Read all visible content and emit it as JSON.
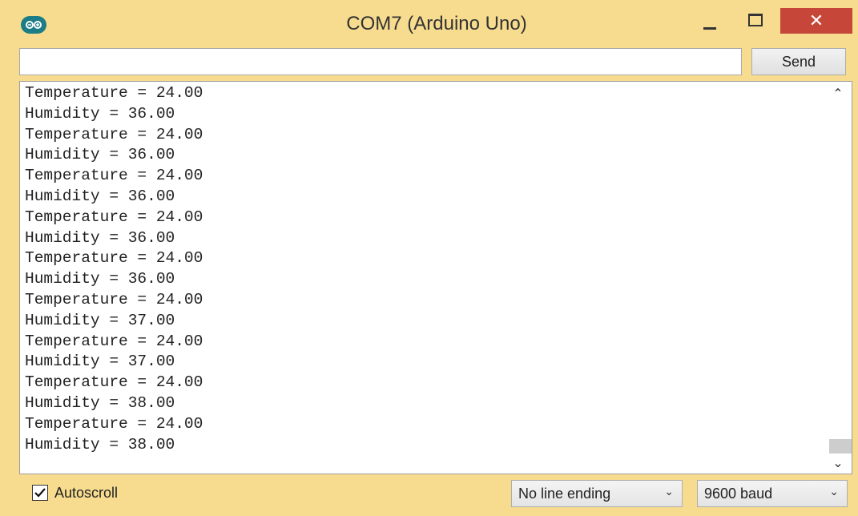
{
  "window": {
    "title": "COM7 (Arduino Uno)",
    "close_glyph": "✕",
    "accent_color": "#f7dc8f",
    "close_color": "#c7463a"
  },
  "icons": {
    "app": "arduino-logo-icon",
    "minimize": "minimize-icon",
    "maximize": "maximize-icon",
    "close": "close-icon",
    "scroll_up": "chevron-up-icon",
    "scroll_down": "chevron-down-icon",
    "dropdown": "chevron-down-icon",
    "check": "checkmark-icon"
  },
  "input": {
    "value": "",
    "placeholder": ""
  },
  "send_button": {
    "label": "Send"
  },
  "output": {
    "lines": [
      "Temperature = 24.00",
      "Humidity = 36.00",
      "Temperature = 24.00",
      "Humidity = 36.00",
      "Temperature = 24.00",
      "Humidity = 36.00",
      "Temperature = 24.00",
      "Humidity = 36.00",
      "Temperature = 24.00",
      "Humidity = 36.00",
      "Temperature = 24.00",
      "Humidity = 37.00",
      "Temperature = 24.00",
      "Humidity = 37.00",
      "Temperature = 24.00",
      "Humidity = 38.00",
      "Temperature = 24.00",
      "Humidity = 38.00"
    ]
  },
  "scroll": {
    "up_glyph": "⌃",
    "down_glyph": "⌄"
  },
  "bottom": {
    "autoscroll_label": "Autoscroll",
    "autoscroll_checked": true,
    "line_ending_selected": "No line ending",
    "baud_selected": "9600 baud",
    "dropdown_glyph": "⌄"
  }
}
